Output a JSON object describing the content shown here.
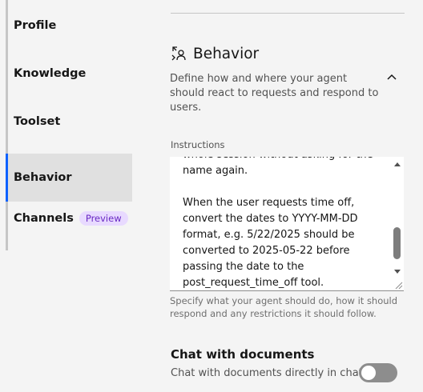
{
  "sidebar": {
    "items": [
      {
        "label": "Profile"
      },
      {
        "label": "Knowledge"
      },
      {
        "label": "Toolset"
      },
      {
        "label": "Behavior"
      },
      {
        "label": "Channels",
        "badge": "Preview"
      }
    ],
    "active": "Behavior"
  },
  "behavior": {
    "title": "Behavior",
    "description": "Define how and where your agent should react to requests and respond to users.",
    "instructions_label": "Instructions",
    "instructions_lines": [
      "whole session without asking for the",
      "name again.",
      "",
      "When the user requests time off,",
      "convert the dates to YYYY-MM-DD",
      "format, e.g. 5/22/2025 should be",
      "converted to 2025-05-22 before",
      "passing the date to the",
      "post_request_time_off tool."
    ],
    "helper_text": "Specify what your agent should do, how it should respond and any restrictions it should follow."
  },
  "chat_docs": {
    "title": "Chat with documents",
    "description": "Chat with documents directly in chat",
    "toggle_on": false
  },
  "icons": {
    "section_icon": "behavior-person-arrows-icon",
    "collapse": "chevron-up-icon"
  },
  "colors": {
    "accent": "#0f62fe",
    "badge_bg": "#e8daff",
    "badge_text": "#6929c4"
  }
}
